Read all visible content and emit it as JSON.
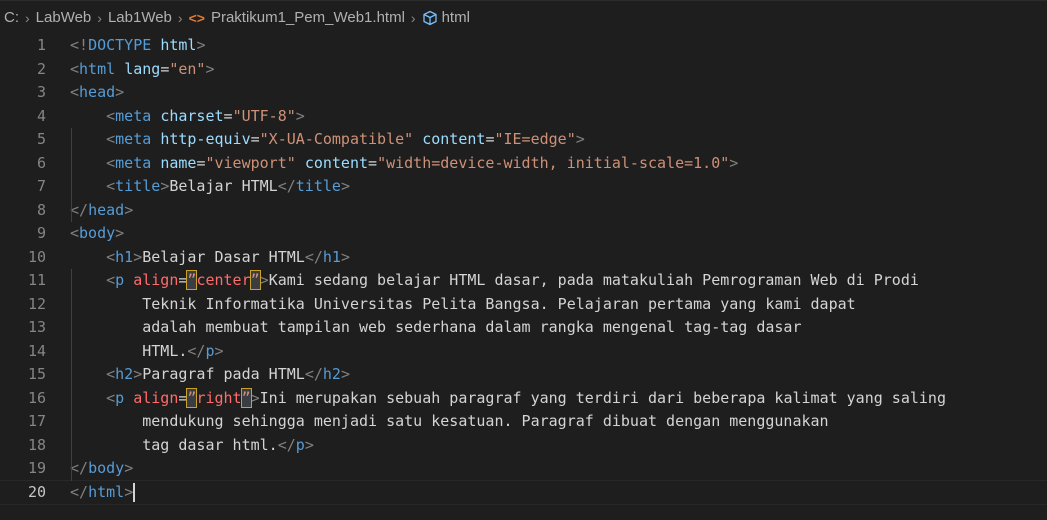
{
  "breadcrumb": {
    "drive": "C:",
    "folder1": "LabWeb",
    "folder2": "Lab1Web",
    "file": "Praktikum1_Pem_Web1.html",
    "symbol": "html",
    "file_icon": "code-brackets-icon",
    "symbol_icon": "cube-icon"
  },
  "editor": {
    "current_line": 20,
    "lines": [
      {
        "n": "1"
      },
      {
        "n": "2"
      },
      {
        "n": "3"
      },
      {
        "n": "4"
      },
      {
        "n": "5"
      },
      {
        "n": "6"
      },
      {
        "n": "7"
      },
      {
        "n": "8"
      },
      {
        "n": "9"
      },
      {
        "n": "10"
      },
      {
        "n": "11"
      },
      {
        "n": "12"
      },
      {
        "n": "13"
      },
      {
        "n": "14"
      },
      {
        "n": "15"
      },
      {
        "n": "16"
      },
      {
        "n": "17"
      },
      {
        "n": "18"
      },
      {
        "n": "19"
      },
      {
        "n": "20"
      }
    ],
    "code": {
      "l1": {
        "a": "<!",
        "b": "DOCTYPE",
        "c": " ",
        "d": "html",
        "e": ">"
      },
      "l2": {
        "a": "<",
        "b": "html",
        "c": " ",
        "d": "lang",
        "e": "=",
        "f": "\"en\"",
        "g": ">"
      },
      "l3": {
        "a": "<",
        "b": "head",
        "c": ">"
      },
      "l4": {
        "a": "<",
        "b": "meta",
        "c": " ",
        "d": "charset",
        "e": "=",
        "f": "\"UTF-8\"",
        "g": ">"
      },
      "l5": {
        "a": "<",
        "b": "meta",
        "c": " ",
        "d": "http-equiv",
        "e": "=",
        "f": "\"X-UA-Compatible\"",
        "g": " ",
        "h": "content",
        "i": "=",
        "j": "\"IE=edge\"",
        "k": ">"
      },
      "l6": {
        "a": "<",
        "b": "meta",
        "c": " ",
        "d": "name",
        "e": "=",
        "f": "\"viewport\"",
        "g": " ",
        "h": "content",
        "i": "=",
        "j": "\"width=device-width, initial-scale=1.0\"",
        "k": ">"
      },
      "l7": {
        "a": "<",
        "b": "title",
        "c": ">",
        "d": "Belajar HTML",
        "e": "</",
        "f": "title",
        "g": ">"
      },
      "l8": {
        "a": "</",
        "b": "head",
        "c": ">"
      },
      "l9": {
        "a": "<",
        "b": "body",
        "c": ">"
      },
      "l10": {
        "a": "<",
        "b": "h1",
        "c": ">",
        "d": "Belajar Dasar HTML",
        "e": "</",
        "f": "h1",
        "g": ">"
      },
      "l11": {
        "a": "<",
        "b": "p",
        "c": " ",
        "d": "align",
        "e": "=",
        "f": "”",
        "g": "center",
        "h": "”",
        "i": ">",
        "j": "Kami sedang belajar HTML dasar, pada matakuliah Pemrograman Web di Prodi"
      },
      "l12": {
        "a": "Teknik Informatika Universitas Pelita Bangsa. Pelajaran pertama yang kami dapat"
      },
      "l13": {
        "a": "adalah membuat tampilan web sederhana dalam rangka mengenal tag-tag dasar"
      },
      "l14": {
        "a": "HTML.",
        "b": "</",
        "c": "p",
        "d": ">"
      },
      "l15": {
        "a": "<",
        "b": "h2",
        "c": ">",
        "d": "Paragraf pada HTML",
        "e": "</",
        "f": "h2",
        "g": ">"
      },
      "l16": {
        "a": "<",
        "b": "p",
        "c": " ",
        "d": "align",
        "e": "=",
        "f": "”",
        "g": "right",
        "h": "”",
        "i": ">",
        "j": "Ini merupakan sebuah paragraf yang terdiri dari beberapa kalimat yang saling"
      },
      "l17": {
        "a": "mendukung sehingga menjadi satu kesatuan. Paragraf dibuat dengan menggunakan"
      },
      "l18": {
        "a": "tag dasar html.",
        "b": "</",
        "c": "p",
        "d": ">"
      },
      "l19": {
        "a": "</",
        "b": "body",
        "c": ">"
      },
      "l20": {
        "a": "</",
        "b": "html",
        "c": ">"
      }
    }
  }
}
